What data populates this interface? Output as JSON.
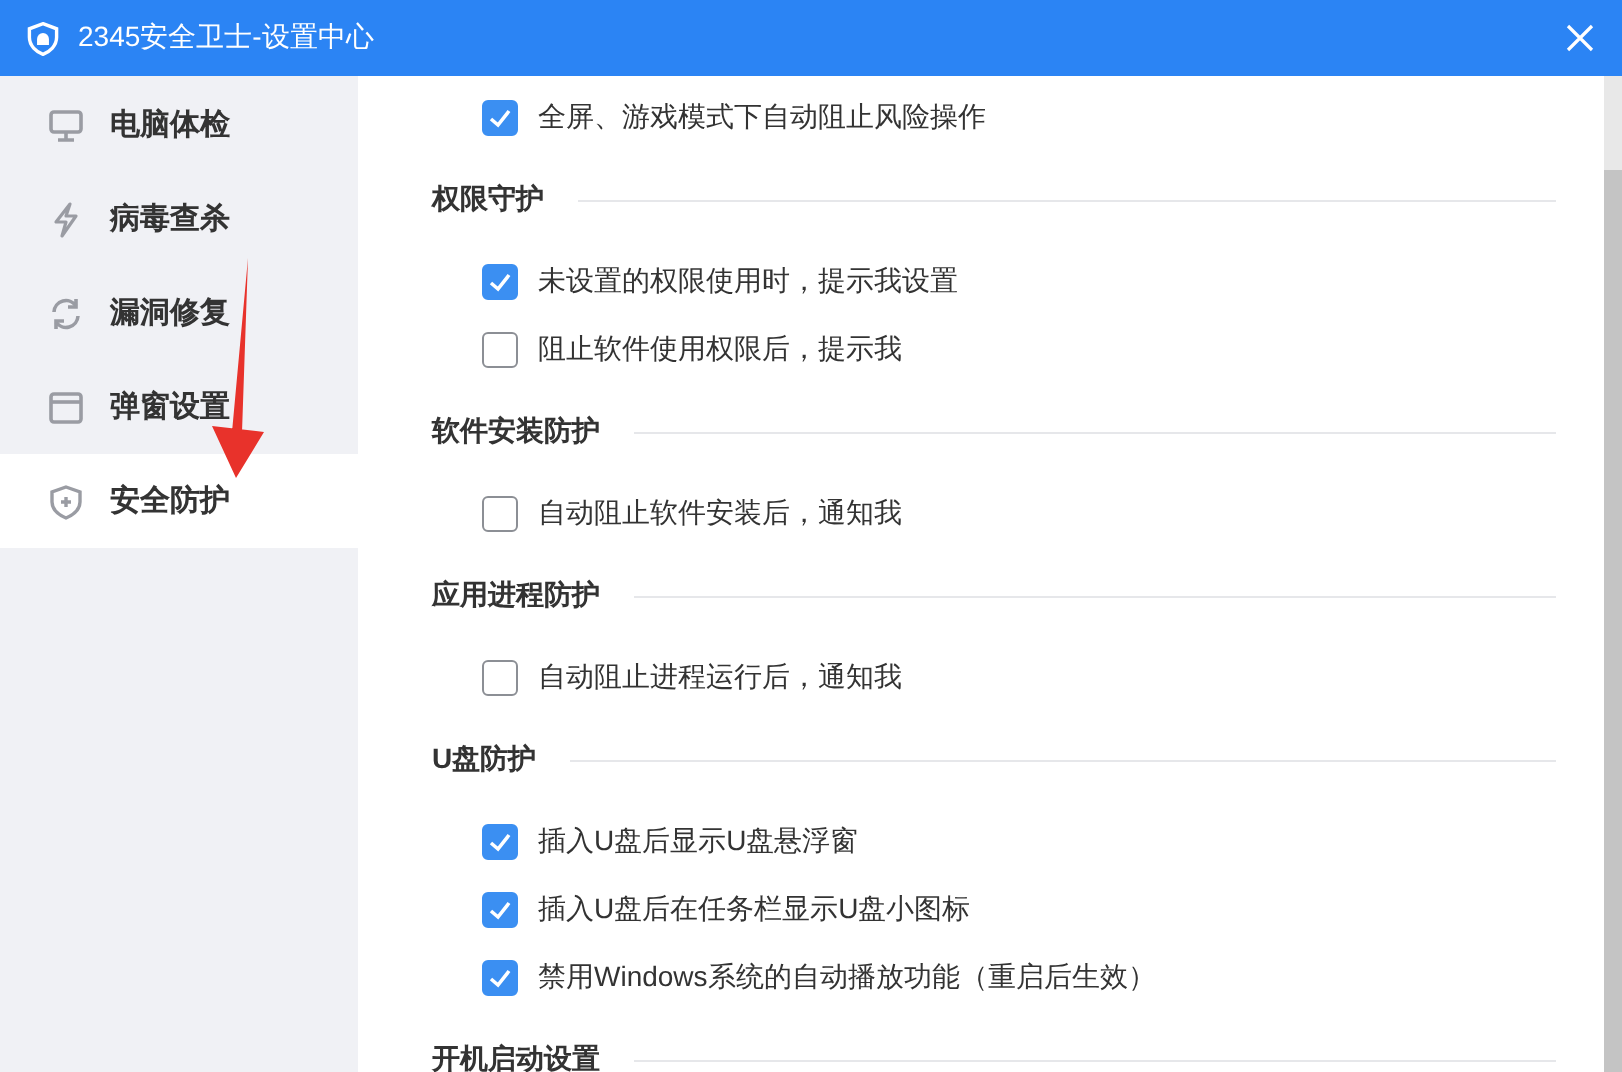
{
  "window": {
    "title": "2345安全卫士-设置中心"
  },
  "sidebar": {
    "items": [
      {
        "label": "电脑体检",
        "selected": false
      },
      {
        "label": "病毒查杀",
        "selected": false
      },
      {
        "label": "漏洞修复",
        "selected": false
      },
      {
        "label": "弹窗设置",
        "selected": false
      },
      {
        "label": "安全防护",
        "selected": true
      }
    ]
  },
  "sections": [
    {
      "items": [
        {
          "label": "全屏、游戏模式下自动阻止风险操作",
          "checked": true
        }
      ]
    },
    {
      "title": "权限守护",
      "items": [
        {
          "label": "未设置的权限使用时，提示我设置",
          "checked": true
        },
        {
          "label": "阻止软件使用权限后，提示我",
          "checked": false
        }
      ]
    },
    {
      "title": "软件安装防护",
      "items": [
        {
          "label": "自动阻止软件安装后，通知我",
          "checked": false
        }
      ]
    },
    {
      "title": "应用进程防护",
      "items": [
        {
          "label": "自动阻止进程运行后，通知我",
          "checked": false
        }
      ]
    },
    {
      "title": "U盘防护",
      "items": [
        {
          "label": "插入U盘后显示U盘悬浮窗",
          "checked": true
        },
        {
          "label": "插入U盘后在任务栏显示U盘小图标",
          "checked": true
        },
        {
          "label": "禁用Windows系统的自动播放功能（重启后生效）",
          "checked": true
        }
      ]
    },
    {
      "title": "开机启动设置"
    }
  ]
}
